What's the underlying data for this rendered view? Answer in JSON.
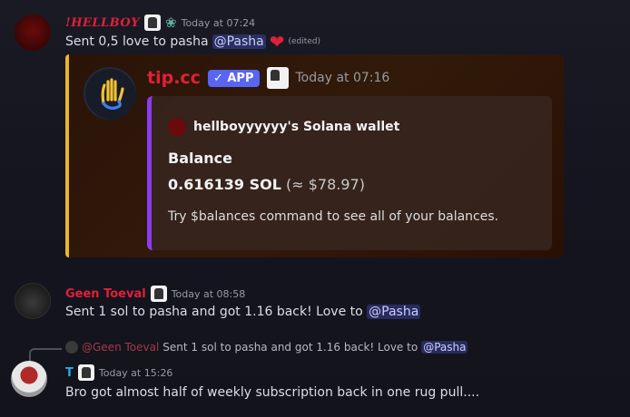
{
  "messages": {
    "m1": {
      "author": "!HELLBOY",
      "timestamp": "Today at 07:24",
      "text": "Sent 0,5 love to pasha",
      "mention": "@Pasha",
      "edited": "(edited)"
    },
    "embed": {
      "bot_name": "tip.cc",
      "app_tag": "✓ APP",
      "timestamp": "Today at 07:16",
      "wallet_title": "hellboyyyyyy's Solana wallet",
      "balance_label": "Balance",
      "balance_value": "0.616139 SOL",
      "balance_usd": "(≈ $78.97)",
      "hint": "Try $balances command to see all of your balances."
    },
    "m2": {
      "author": "Geen Toeval",
      "timestamp": "Today at 08:58",
      "text": "Sent 1 sol to pasha and got 1.16 back! Love to",
      "mention": "@Pasha"
    },
    "reply": {
      "author": "@Geen Toeval",
      "text": "Sent 1 sol to pasha and got 1.16 back! Love to",
      "mention": "@Pasha"
    },
    "m3": {
      "author": "T",
      "timestamp": "Today at 15:26",
      "text": "Bro got almost half of weekly subscription back in one rug pull...."
    }
  },
  "colors": {
    "accent_red": "#e0203a",
    "embed_gold": "#e8b62a",
    "wallet_purple": "#8b3cf0",
    "app_blue": "#5865f2",
    "t_blue": "#2ea8e0"
  }
}
